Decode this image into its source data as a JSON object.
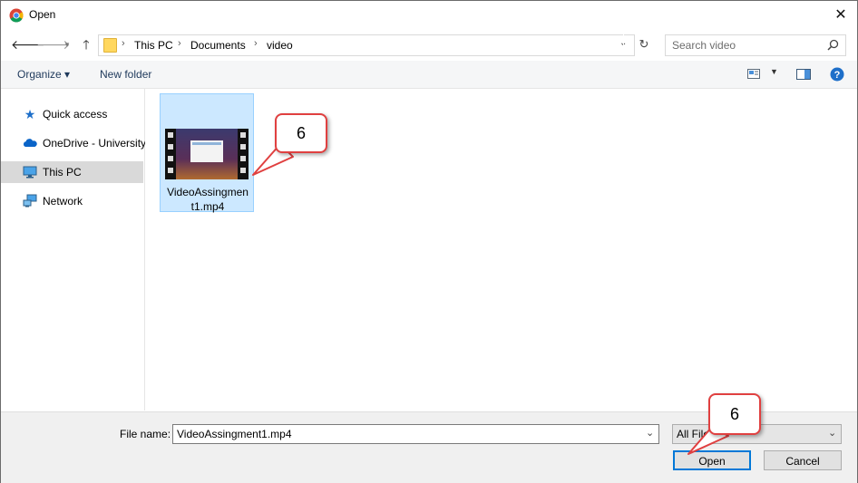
{
  "window": {
    "title": "Open",
    "app_icon": "chrome-icon",
    "close_label": "✕"
  },
  "nav": {
    "back_icon": "arrow-left-icon",
    "forward_icon": "arrow-right-icon",
    "recent_icon": "chevron-down-icon",
    "up_icon": "arrow-up-icon",
    "breadcrumbs": [
      "This PC",
      "Documents",
      "video"
    ],
    "search_placeholder": "Search video"
  },
  "toolbar": {
    "organize_label": "Organize ▾",
    "new_folder_label": "New folder"
  },
  "sidebar": {
    "items": [
      {
        "label": "Quick access",
        "icon": "star-icon"
      },
      {
        "label": "OneDrive - University",
        "icon": "cloud-icon"
      },
      {
        "label": "This PC",
        "icon": "computer-icon",
        "selected": true
      },
      {
        "label": "Network",
        "icon": "network-icon"
      }
    ]
  },
  "files": [
    {
      "name": "VideoAssingment1.mp4",
      "display": "VideoAssingmen t1.mp4",
      "type": "video"
    }
  ],
  "bottom": {
    "file_name_label": "File name:",
    "file_name_value": "VideoAssingment1.mp4",
    "file_type_value": "All Files",
    "open_label": "Open",
    "cancel_label": "Cancel"
  },
  "annotations": {
    "callout_top": "6",
    "callout_bottom": "6",
    "color": "#e04040"
  }
}
